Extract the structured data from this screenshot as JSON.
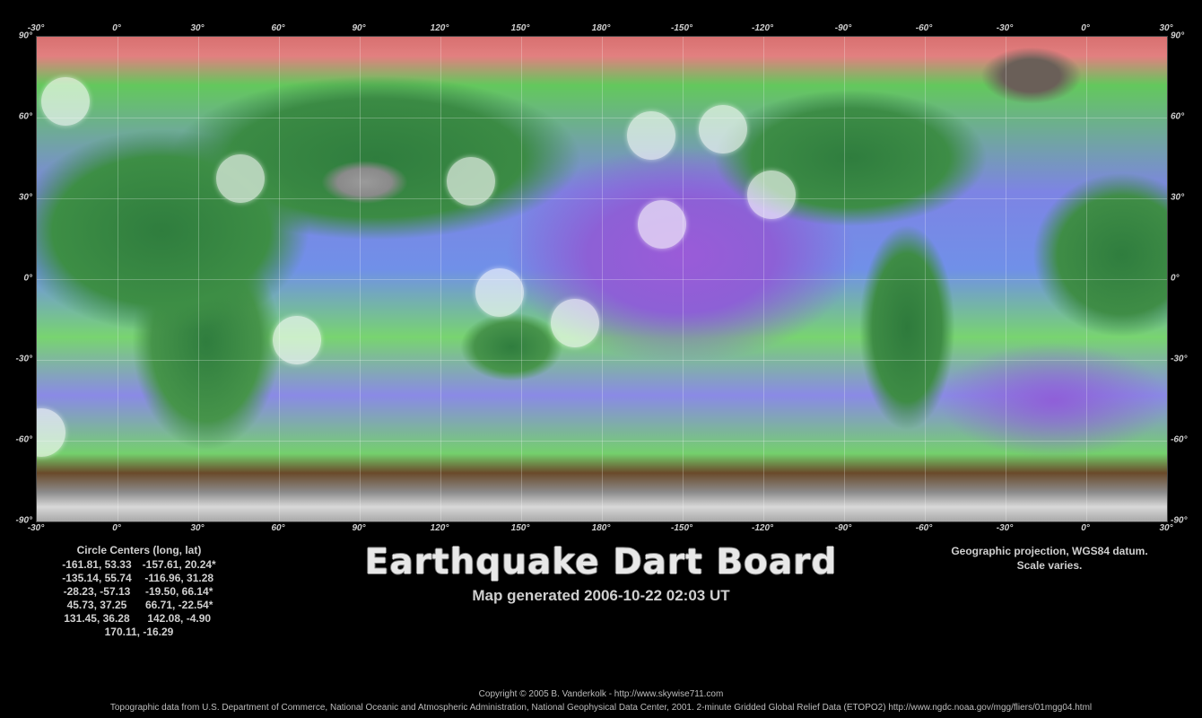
{
  "map": {
    "top_ticks": [
      "-30°",
      "0°",
      "30°",
      "60°",
      "90°",
      "120°",
      "150°",
      "180°",
      "-150°",
      "-120°",
      "-90°",
      "-60°",
      "-30°",
      "0°",
      "30°"
    ],
    "bottom_ticks": [
      "-30°",
      "0°",
      "30°",
      "60°",
      "90°",
      "120°",
      "150°",
      "180°",
      "-150°",
      "-120°",
      "-90°",
      "-60°",
      "-30°",
      "0°",
      "30°"
    ],
    "left_ticks": [
      "90°",
      "60°",
      "30°",
      "0°",
      "-30°",
      "-60°",
      "-90°"
    ],
    "right_ticks": [
      "90°",
      "60°",
      "30°",
      "0°",
      "-30°",
      "-60°",
      "-90°"
    ],
    "lon_range": [
      -30,
      390
    ],
    "lat_range": [
      90,
      -90
    ],
    "circles": [
      {
        "lon": -161.81,
        "lat": 53.33
      },
      {
        "lon": -157.61,
        "lat": 20.24
      },
      {
        "lon": -135.14,
        "lat": 55.74
      },
      {
        "lon": -116.96,
        "lat": 31.28
      },
      {
        "lon": -28.23,
        "lat": -57.13
      },
      {
        "lon": -19.5,
        "lat": 66.14
      },
      {
        "lon": 45.73,
        "lat": 37.25
      },
      {
        "lon": 66.71,
        "lat": -22.54
      },
      {
        "lon": 131.45,
        "lat": 36.28
      },
      {
        "lon": 142.08,
        "lat": -4.9
      },
      {
        "lon": 170.11,
        "lat": -16.29
      }
    ]
  },
  "circle_centers": {
    "heading": "Circle Centers (long, lat)",
    "rows": [
      [
        "-161.81,  53.33",
        "-157.61,  20.24*"
      ],
      [
        "-135.14,  55.74",
        "-116.96,  31.28"
      ],
      [
        "-28.23, -57.13",
        "-19.50,  66.14*"
      ],
      [
        "45.73,  37.25",
        "66.71, -22.54*"
      ],
      [
        "131.45,  36.28",
        "142.08,  -4.90"
      ]
    ],
    "last": "170.11, -16.29"
  },
  "title": "Earthquake Dart Board",
  "subtitle": "Map generated 2006-10-22 02:03 UT",
  "projection_line1": "Geographic projection, WGS84 datum.",
  "projection_line2": "Scale varies.",
  "copyright": "Copyright © 2005 B. Vanderkolk - http://www.skywise711.com",
  "credits": "Topographic data from U.S. Department of Commerce, National Oceanic and Atmospheric Administration, National Geophysical Data Center, 2001. 2-minute Gridded Global Relief Data (ETOPO2) http://www.ngdc.noaa.gov/mgg/fliers/01mgg04.html"
}
